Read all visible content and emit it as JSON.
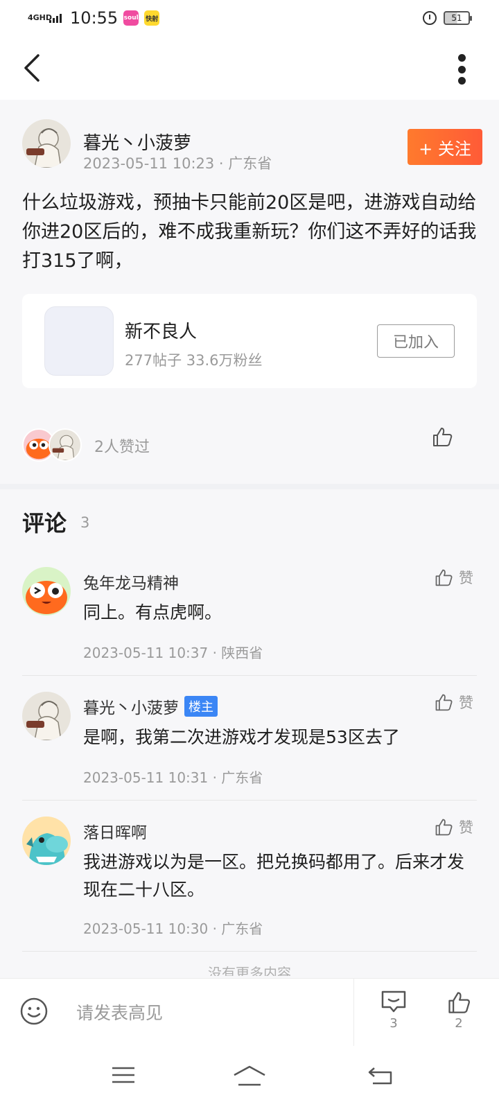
{
  "status_bar": {
    "network": "4GHD",
    "time": "10:55",
    "app_badge_1": "soul",
    "app_badge_2": "快射",
    "battery": "51"
  },
  "nav": {
    "back_icon": "chevron-left-icon",
    "more_icon": "more-vertical-icon"
  },
  "post": {
    "author": "暮光丶小菠萝",
    "meta": "2023-05-11  10:23 · 广东省",
    "follow_label": "+ 关注",
    "content": "什么垃圾游戏，预抽卡只能前20区是吧，进游戏自动给你进20区后的，难不成我重新玩？你们这不弄好的话我打315了啊，",
    "forum": {
      "name": "新不良人",
      "stats": "277帖子   33.6万粉丝",
      "joined_label": "已加入"
    },
    "likes_text": "2人赞过"
  },
  "comments_section": {
    "title": "评论",
    "count": "3",
    "like_label": "赞",
    "items": [
      {
        "author": "兔年龙马精神",
        "is_op": false,
        "text": "同上。有点虎啊。",
        "meta": "2023-05-11  10:37 · 陕西省"
      },
      {
        "author": "暮光丶小菠萝",
        "is_op": true,
        "op_badge": "楼主",
        "text": "是啊，我第二次进游戏才发现是53区去了",
        "meta": "2023-05-11  10:31 · 广东省"
      },
      {
        "author": "落日晖啊",
        "is_op": false,
        "text": "我进游戏以为是一区。把兑换码都用了。后来才发现在二十八区。",
        "meta": "2023-05-11  10:30 · 广东省"
      }
    ],
    "more_hint": "没有更多内容"
  },
  "bottom_bar": {
    "reply_placeholder": "请发表高见",
    "comment_count": "3",
    "like_count": "2"
  },
  "colors": {
    "accent_orange": "#ff6a32",
    "op_badge_blue": "#3b86f5",
    "meta_gray": "#9a9a9a"
  }
}
